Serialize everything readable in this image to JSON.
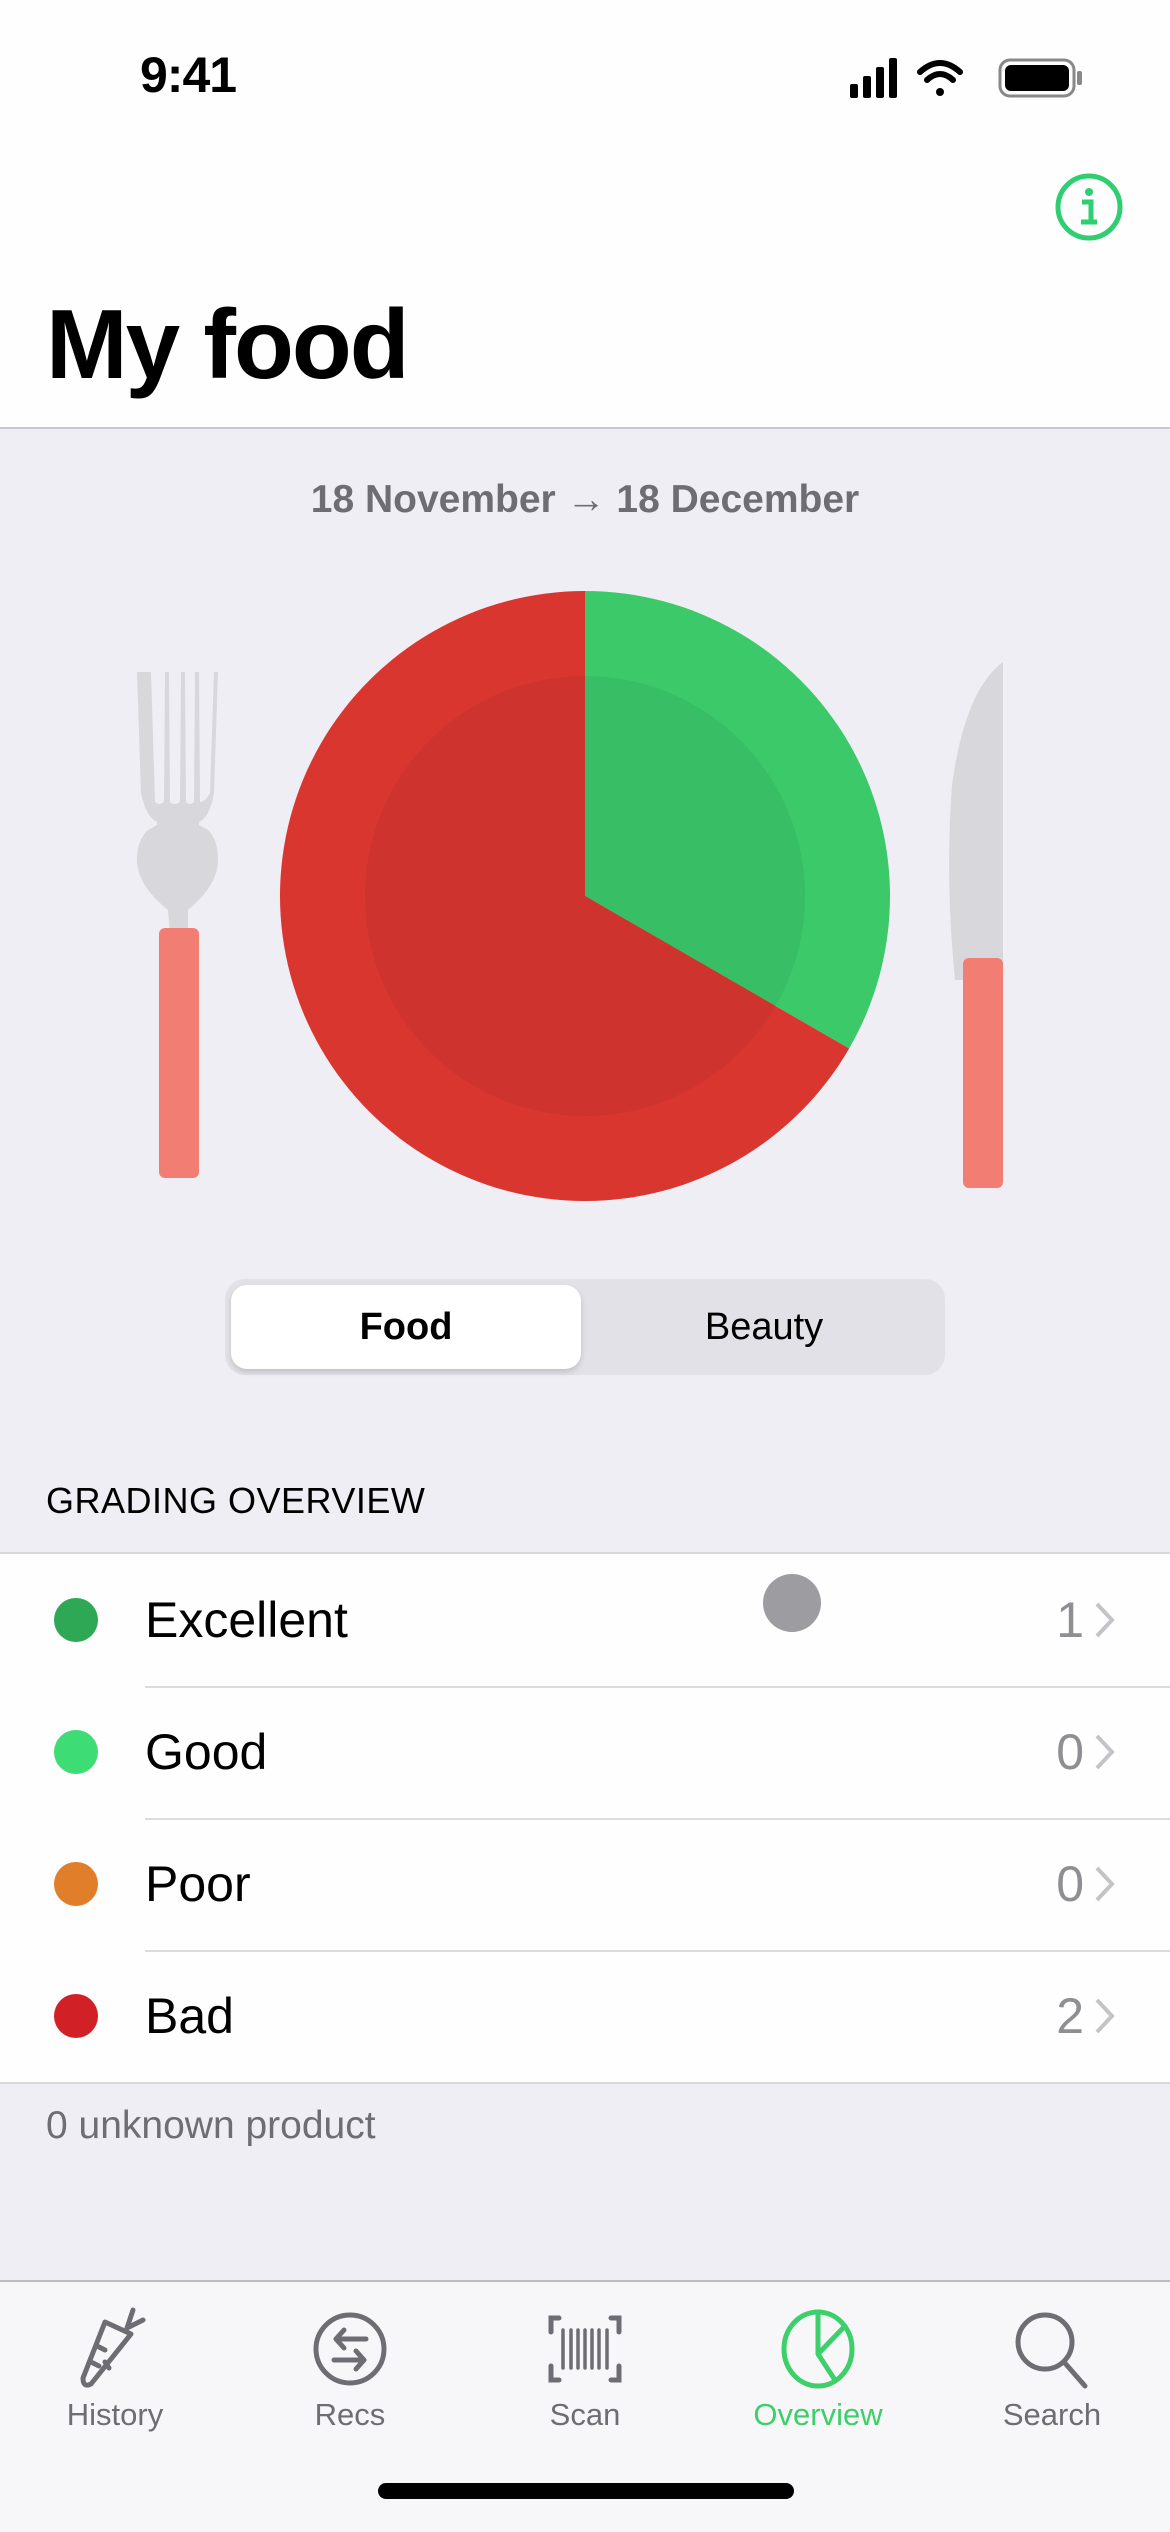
{
  "status_bar": {
    "time": "9:41"
  },
  "header": {
    "title": "My food",
    "info_icon": "info-circle-icon"
  },
  "period": {
    "label": "18 November → 18 December"
  },
  "segmented_control": {
    "options": [
      {
        "label": "Food",
        "selected": true
      },
      {
        "label": "Beauty",
        "selected": false
      }
    ]
  },
  "grading": {
    "section_title": "GRADING OVERVIEW",
    "rows": [
      {
        "label": "Excellent",
        "count": "1",
        "color": "#2ea855"
      },
      {
        "label": "Good",
        "count": "0",
        "color": "#3ddc74"
      },
      {
        "label": "Poor",
        "count": "0",
        "color": "#e07e2a"
      },
      {
        "label": "Bad",
        "count": "2",
        "color": "#d12127"
      }
    ],
    "unknown_text": "0 unknown product"
  },
  "chart_data": {
    "type": "pie",
    "title": "",
    "categories": [
      "Excellent",
      "Good",
      "Poor",
      "Bad"
    ],
    "values": [
      1,
      0,
      0,
      2
    ],
    "colors": [
      "#3bc96a",
      "#3ddc74",
      "#e07e2a",
      "#d93630"
    ],
    "start_angle": "12 o'clock, clockwise"
  },
  "tabbar": {
    "items": [
      {
        "label": "History",
        "icon": "carrot-icon",
        "active": false
      },
      {
        "label": "Recs",
        "icon": "swap-arrows-icon",
        "active": false
      },
      {
        "label": "Scan",
        "icon": "barcode-icon",
        "active": false
      },
      {
        "label": "Overview",
        "icon": "pie-chart-icon",
        "active": true
      },
      {
        "label": "Search",
        "icon": "search-icon",
        "active": false
      }
    ]
  },
  "colors": {
    "accent": "#3ccf6a",
    "inactive_tab": "#6e6d73"
  }
}
